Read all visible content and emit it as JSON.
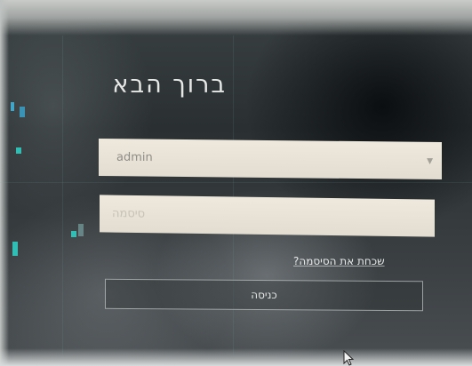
{
  "login": {
    "title": "ברוך הבא",
    "username_value": "admin",
    "password_placeholder": "סיסמה",
    "forgot_password": "שכחת את הסיסמה?",
    "submit_label": "כניסה"
  },
  "icons": {
    "dropdown": "chevron-down-icon",
    "cursor": "mouse-pointer-icon"
  },
  "colors": {
    "field_bg": "#e9e3d7",
    "accent_teal": "#2fd3c8",
    "text_light": "#e6e8e6"
  }
}
